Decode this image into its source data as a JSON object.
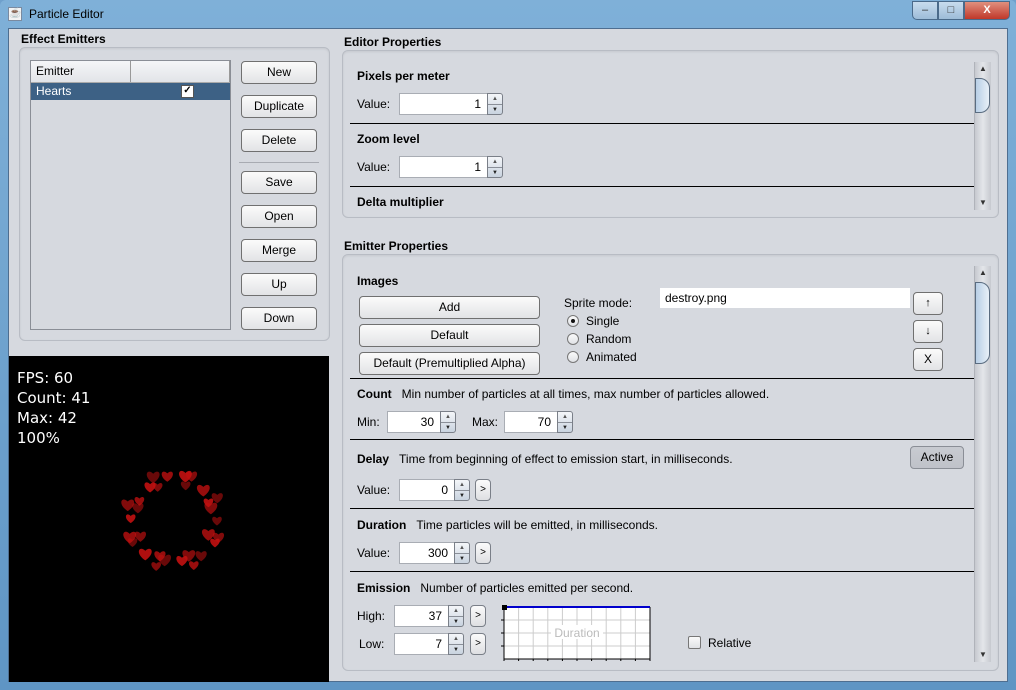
{
  "window": {
    "title": "Particle Editor",
    "controls": {
      "minimize": "–",
      "maximize": "□",
      "close": "X"
    }
  },
  "emitters_panel": {
    "title": "Effect Emitters",
    "table": {
      "columns": [
        "Emitter",
        ""
      ],
      "rows": [
        {
          "name": "Hearts",
          "enabled": true,
          "check_glyph": "✓"
        }
      ]
    },
    "buttons": {
      "new": "New",
      "duplicate": "Duplicate",
      "delete": "Delete",
      "save": "Save",
      "open": "Open",
      "merge": "Merge",
      "up": "Up",
      "down": "Down"
    }
  },
  "preview": {
    "fps": "FPS: 60",
    "count": "Count: 41",
    "max": "Max: 42",
    "zoom": "100%",
    "particle_color": "#c01010"
  },
  "editor_properties": {
    "title": "Editor Properties",
    "sections": [
      {
        "title": "Pixels per meter",
        "label": "Value:",
        "value": "1"
      },
      {
        "title": "Zoom level",
        "label": "Value:",
        "value": "1"
      },
      {
        "title": "Delta multiplier"
      }
    ]
  },
  "emitter_properties": {
    "title": "Emitter Properties",
    "images": {
      "title": "Images",
      "buttons": {
        "add": "Add",
        "default": "Default",
        "default_premult": "Default (Premultiplied Alpha)"
      },
      "sprite_mode_label": "Sprite mode:",
      "sprite_modes": [
        {
          "label": "Single",
          "selected": true
        },
        {
          "label": "Random",
          "selected": false
        },
        {
          "label": "Animated",
          "selected": false
        }
      ],
      "file": "destroy.png",
      "move_up": "↑",
      "move_down": "↓",
      "remove": "X"
    },
    "count": {
      "title": "Count",
      "description": "Min number of particles at all times, max number of particles allowed.",
      "min_label": "Min:",
      "min": "30",
      "max_label": "Max:",
      "max": "70"
    },
    "delay": {
      "title": "Delay",
      "description": "Time from beginning of effect to emission start, in milliseconds.",
      "label": "Value:",
      "value": "0",
      "active_button": "Active",
      "expand": ">"
    },
    "duration": {
      "title": "Duration",
      "description": "Time particles will be emitted, in milliseconds.",
      "label": "Value:",
      "value": "300",
      "expand": ">"
    },
    "emission": {
      "title": "Emission",
      "description": "Number of particles emitted per second.",
      "high_label": "High:",
      "high": "37",
      "low_label": "Low:",
      "low": "7",
      "expand": ">",
      "chart_label": "Duration",
      "relative_label": "Relative",
      "relative": false,
      "add_point": "+",
      "curve_color": "#0000cc"
    }
  },
  "scroll": {
    "up": "▲",
    "down": "▼"
  }
}
